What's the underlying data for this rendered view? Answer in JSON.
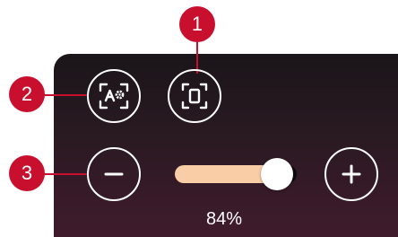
{
  "colors": {
    "callout": "#c8102e",
    "slider_fill": "#f9cda6",
    "slider_track": "#0b0b0d",
    "panel_top": "#1a1519",
    "panel_bottom": "#401b2c",
    "icon": "#ffffff"
  },
  "toolbar": {
    "auto_format_icon": "auto-format-icon",
    "fit_to_frame_icon": "fit-frame-icon"
  },
  "zoom": {
    "value": 0.84,
    "label": "84%",
    "minus_icon": "minus-icon",
    "plus_icon": "plus-icon"
  },
  "callouts": [
    {
      "label": "1",
      "target": "fit-frame-button"
    },
    {
      "label": "2",
      "target": "auto-format-button"
    },
    {
      "label": "3",
      "target": "zoom-out-button"
    }
  ]
}
